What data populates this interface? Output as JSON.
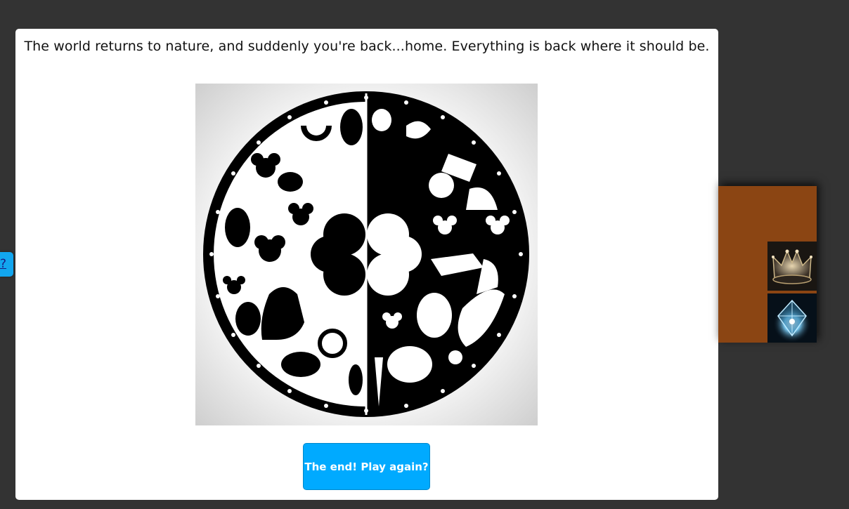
{
  "story": {
    "text": "The world returns to nature, and suddenly you're back...home. Everything is back where it should be."
  },
  "illustration": {
    "subject": "black-and-white circular emblem split in half: natural symbols (clovers, horseshoe, cat, horse, leaves) and objects (pot of gold, helmet, crystal, hammer)"
  },
  "actions": {
    "play_again_label": "The end! Play again?"
  },
  "help": {
    "label": "?"
  },
  "inventory": {
    "panel_color": "#8b4513",
    "items": [
      {
        "icon": "crown-icon"
      },
      {
        "icon": "crystal-icon"
      }
    ]
  },
  "colors": {
    "background": "#333333",
    "dialog": "#ffffff",
    "button": "#00aaff",
    "help_tab": "#12a6ef"
  }
}
